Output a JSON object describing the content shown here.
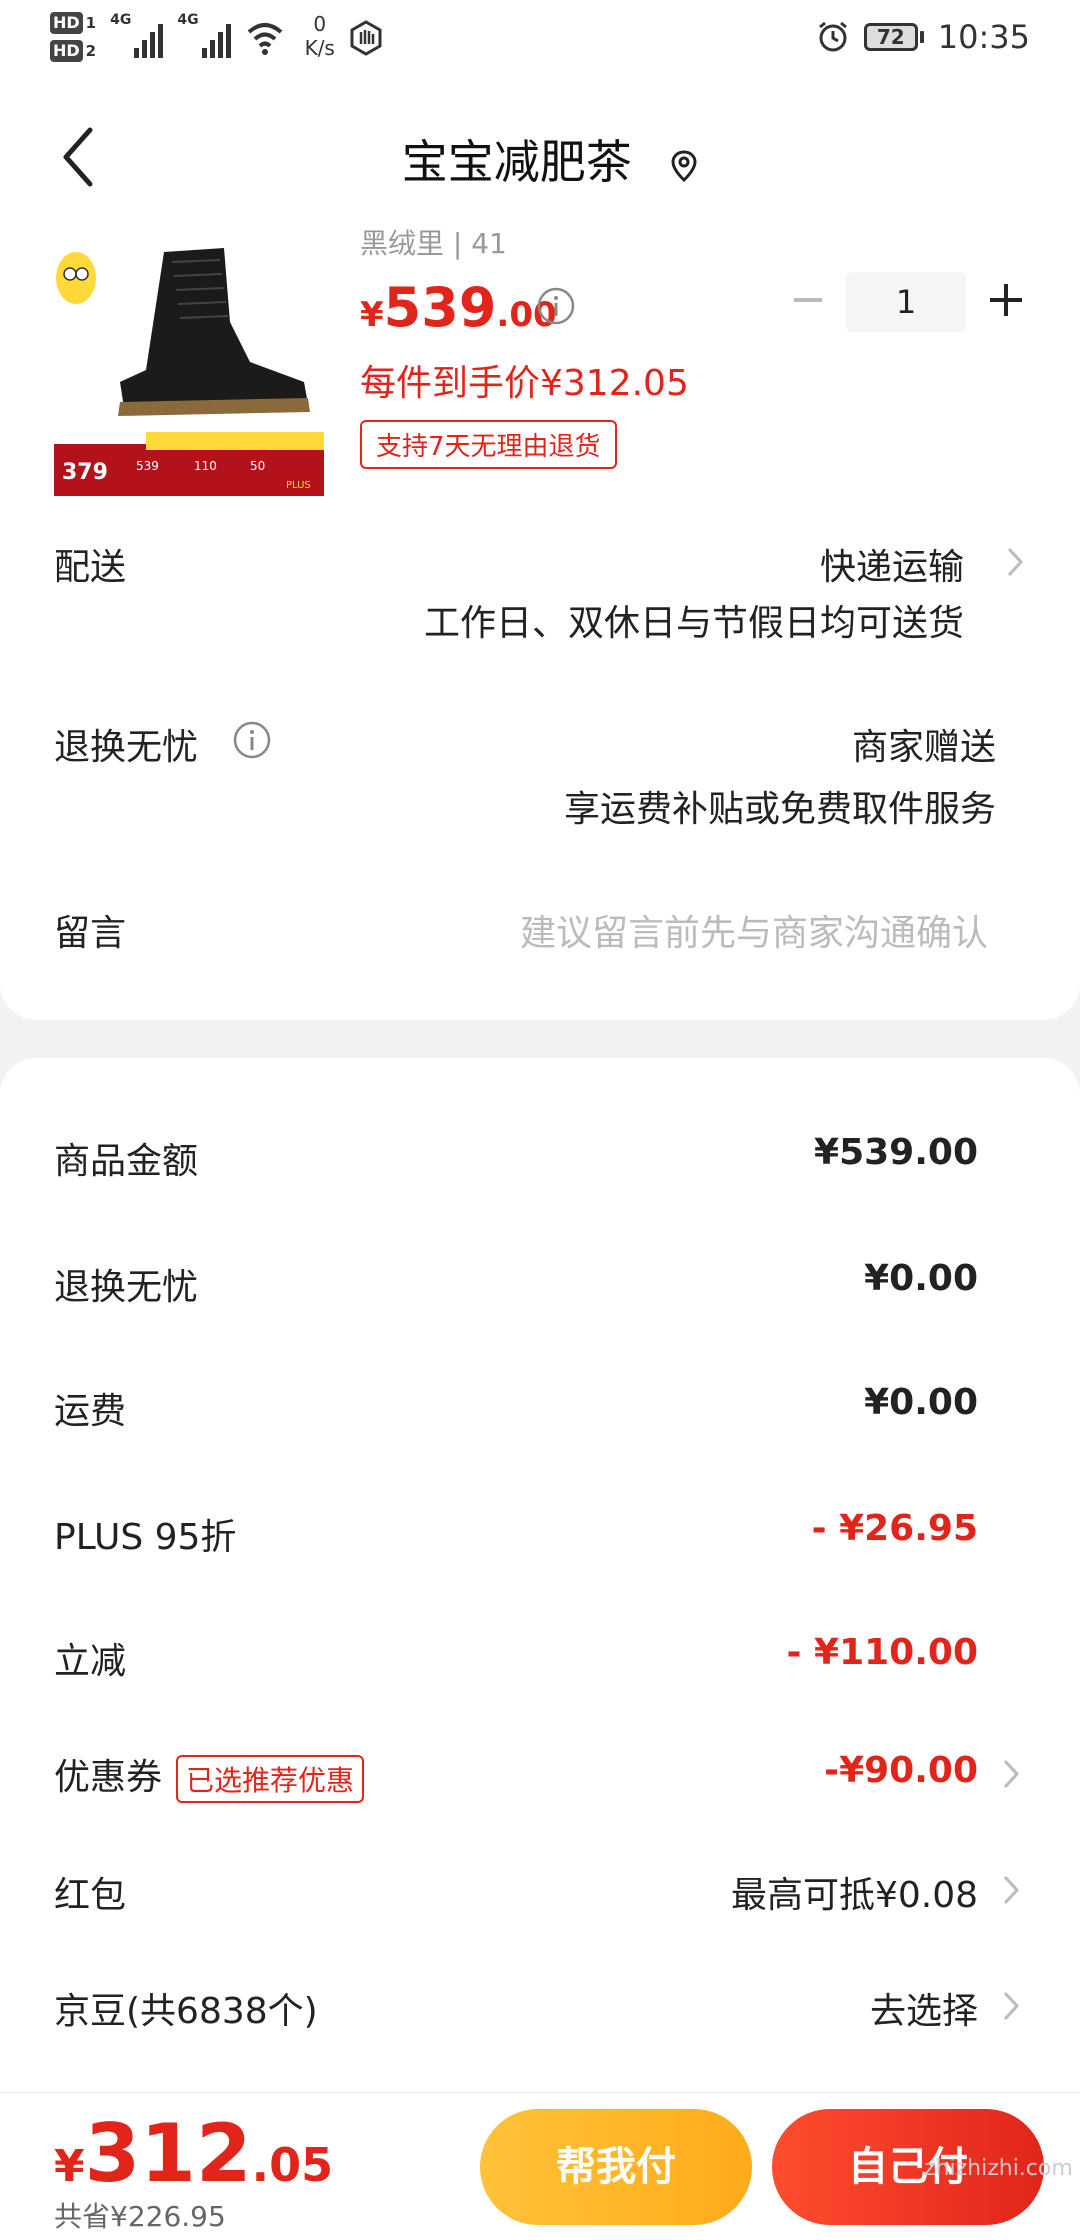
{
  "status_bar": {
    "hd1": "HD",
    "hd1_sub": "1",
    "hd2": "HD",
    "hd2_sub": "2",
    "net1": "4G",
    "net2": "4G",
    "speed_value": "0",
    "speed_unit": "K/s",
    "battery": "72",
    "time": "10:35"
  },
  "header": {
    "title": "宝宝减肥茶"
  },
  "product": {
    "spec": "黑绒里 | 41",
    "price_symbol": "¥",
    "price_int": "539",
    "price_dec": ".00",
    "per_item_price": "每件到手价¥312.05",
    "return_tag": "支持7天无理由退货",
    "quantity": "1",
    "image_badge_price": "379",
    "image_badge_a": "539",
    "image_badge_b": "110",
    "image_badge_c": "50",
    "image_badge_plus": "PLUS"
  },
  "delivery": {
    "label": "配送",
    "value": "快递运输",
    "detail": "工作日、双休日与节假日均可送货"
  },
  "return_service": {
    "label": "退换无忧",
    "value": "商家赠送",
    "detail": "享运费补贴或免费取件服务"
  },
  "message": {
    "label": "留言",
    "placeholder": "建议留言前先与商家沟通确认"
  },
  "fees": {
    "goods_label": "商品金额",
    "goods_value": "¥539.00",
    "return_label": "退换无忧",
    "return_value": "¥0.00",
    "shipping_label": "运费",
    "shipping_value": "¥0.00",
    "plus_label": "PLUS 95折",
    "plus_value": "- ¥26.95",
    "instant_label": "立减",
    "instant_value": "- ¥110.00",
    "coupon_label": "优惠券",
    "coupon_badge": "已选推荐优惠",
    "coupon_value": "-¥90.00",
    "redpacket_label": "红包",
    "redpacket_value": "最高可抵¥0.08",
    "jingdou_label": "京豆(共6838个)",
    "jingdou_value": "去选择"
  },
  "footer": {
    "total_symbol": "¥",
    "total_int": "312",
    "total_dec": ".05",
    "saved": "共省¥226.95",
    "help_pay": "帮我付",
    "self_pay": "自己付",
    "watermark": "zhizhizhi.com"
  },
  "colors": {
    "accent_red": "#e1251b",
    "help_yellow": "#ffb020"
  }
}
